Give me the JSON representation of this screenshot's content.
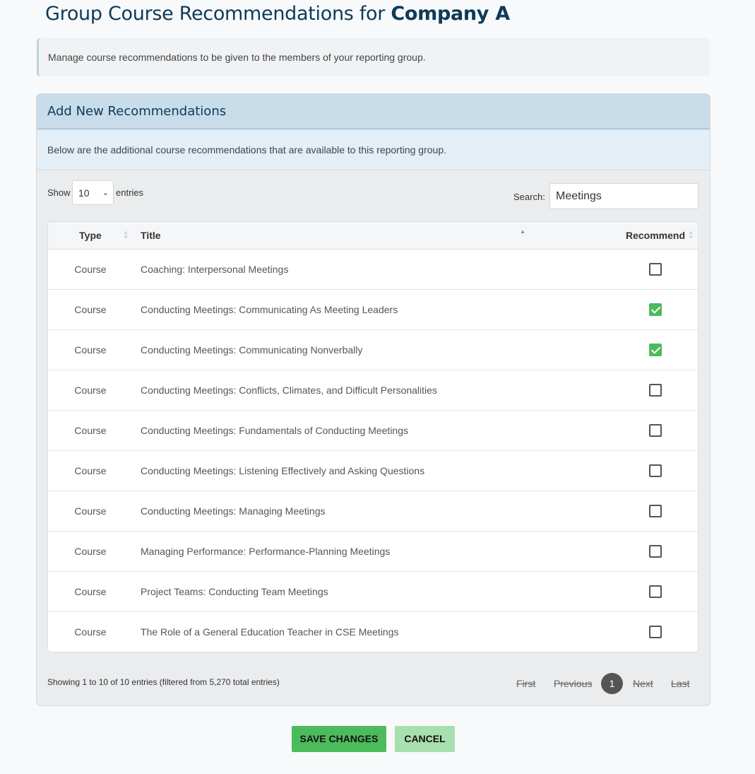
{
  "header": {
    "title_prefix": "Group Course Recommendations for ",
    "company": "Company A"
  },
  "info_text": "Manage course recommendations to be given to the members of your reporting group.",
  "panel": {
    "title": "Add New Recommendations",
    "description": "Below are the additional course recommendations that are available to this reporting group."
  },
  "controls": {
    "show_label": "Show",
    "entries_value": "10",
    "entries_label": "entries",
    "search_label": "Search:",
    "search_value": "Meetings"
  },
  "table": {
    "columns": [
      "Type",
      "Title",
      "Recommend"
    ],
    "rows": [
      {
        "type": "Course",
        "title": "Coaching: Interpersonal Meetings",
        "recommended": false
      },
      {
        "type": "Course",
        "title": "Conducting Meetings: Communicating As Meeting Leaders",
        "recommended": true
      },
      {
        "type": "Course",
        "title": "Conducting Meetings: Communicating Nonverbally",
        "recommended": true
      },
      {
        "type": "Course",
        "title": "Conducting Meetings: Conflicts, Climates, and Difficult Personalities",
        "recommended": false
      },
      {
        "type": "Course",
        "title": "Conducting Meetings: Fundamentals of Conducting Meetings",
        "recommended": false
      },
      {
        "type": "Course",
        "title": "Conducting Meetings: Listening Effectively and Asking Questions",
        "recommended": false
      },
      {
        "type": "Course",
        "title": "Conducting Meetings: Managing Meetings",
        "recommended": false
      },
      {
        "type": "Course",
        "title": "Managing Performance: Performance-Planning Meetings",
        "recommended": false
      },
      {
        "type": "Course",
        "title": "Project Teams: Conducting Team Meetings",
        "recommended": false
      },
      {
        "type": "Course",
        "title": "The Role of a General Education Teacher in CSE Meetings",
        "recommended": false
      }
    ]
  },
  "footer": {
    "info": "Showing 1 to 10 of 10 entries (filtered from 5,270 total entries)"
  },
  "pagination": {
    "first": "First",
    "previous": "Previous",
    "current": "1",
    "next": "Next",
    "last": "Last"
  },
  "buttons": {
    "save": "SAVE CHANGES",
    "cancel": "CANCEL"
  },
  "colors": {
    "accent_green": "#4cbb5c",
    "title_navy": "#0e3a57",
    "panel_header_blue": "#c9dcea"
  }
}
